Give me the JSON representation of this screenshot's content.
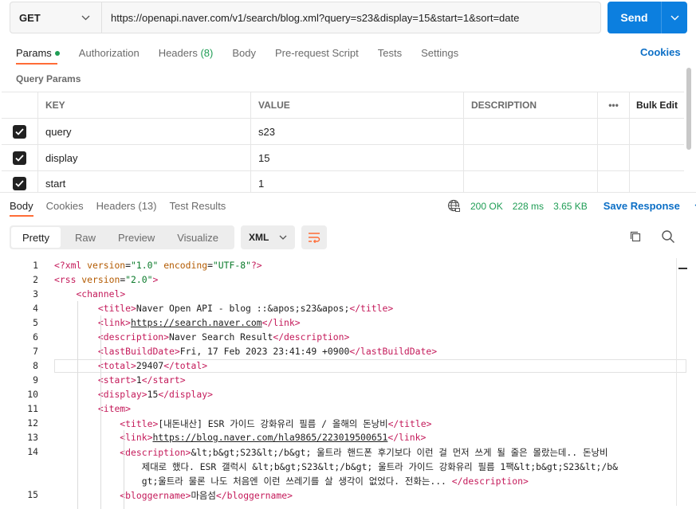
{
  "request": {
    "method": "GET",
    "url": "https://openapi.naver.com/v1/search/blog.xml?query=s23&display=15&start=1&sort=date",
    "send_label": "Send"
  },
  "req_tabs": [
    "Params",
    "Authorization",
    "Headers",
    "Body",
    "Pre-request Script",
    "Tests",
    "Settings"
  ],
  "headers_count": "(8)",
  "cookies_label": "Cookies",
  "query_params_label": "Query Params",
  "table": {
    "headers": [
      "KEY",
      "VALUE",
      "DESCRIPTION"
    ],
    "bulk_edit": "Bulk Edit",
    "more": "•••",
    "rows": [
      {
        "key": "query",
        "value": "s23"
      },
      {
        "key": "display",
        "value": "15"
      },
      {
        "key": "start",
        "value": "1"
      }
    ]
  },
  "resp_tabs": [
    "Body",
    "Cookies",
    "Headers",
    "Test Results"
  ],
  "resp_headers_count": "(13)",
  "status": {
    "code": "200 OK",
    "time": "228 ms",
    "size": "3.65 KB",
    "save": "Save Response"
  },
  "view_modes": [
    "Pretty",
    "Raw",
    "Preview",
    "Visualize"
  ],
  "format": "XML",
  "code_lines": [
    {
      "n": "1",
      "t": "<?xml version=\"1.0\" encoding=\"UTF-8\"?>"
    },
    {
      "n": "2",
      "t": "<rss version=\"2.0\">"
    },
    {
      "n": "3",
      "t": "    <channel>"
    },
    {
      "n": "4",
      "t": "        <title>Naver Open API - blog ::&apos;s23&apos;</title>"
    },
    {
      "n": "5",
      "t": "        <link>https://search.naver.com</link>"
    },
    {
      "n": "6",
      "t": "        <description>Naver Search Result</description>"
    },
    {
      "n": "7",
      "t": "        <lastBuildDate>Fri, 17 Feb 2023 23:41:49 +0900</lastBuildDate>"
    },
    {
      "n": "8",
      "t": "        <total>29407</total>"
    },
    {
      "n": "9",
      "t": "        <start>1</start>"
    },
    {
      "n": "10",
      "t": "        <display>15</display>"
    },
    {
      "n": "11",
      "t": "        <item>"
    },
    {
      "n": "12",
      "t": "            <title>[내돈내산] ESR 가이드 강화유리 필름 / 올해의 돈낭비</title>"
    },
    {
      "n": "13",
      "t": "            <link>https://blog.naver.com/hla9865/223019500651</link>"
    },
    {
      "n": "14",
      "t": "            <description>&lt;b&gt;S23&lt;/b&gt; 울트라 핸드폰 후기보다 이런 걸 먼저 쓰게 될 줄은 몰랐는데.. 돈낭비"
    },
    {
      "n": "",
      "t": "                제대로 했다. ESR 갤럭시 &lt;b&gt;S23&lt;/b&gt; 울트라 가이드 강화유리 필름 1팩&lt;b&gt;S23&lt;/b&"
    },
    {
      "n": "",
      "t": "                gt;울트라 물론 나도 처음엔 이런 쓰레기를 살 생각이 없었다. 전화는... </description>"
    },
    {
      "n": "15",
      "t": "            <bloggername>마음섬</bloggername>"
    }
  ],
  "colors": {
    "accent": "#ff6c37",
    "send": "#0c7fdf",
    "link": "#0c6fc6",
    "ok": "#1f9d55"
  }
}
